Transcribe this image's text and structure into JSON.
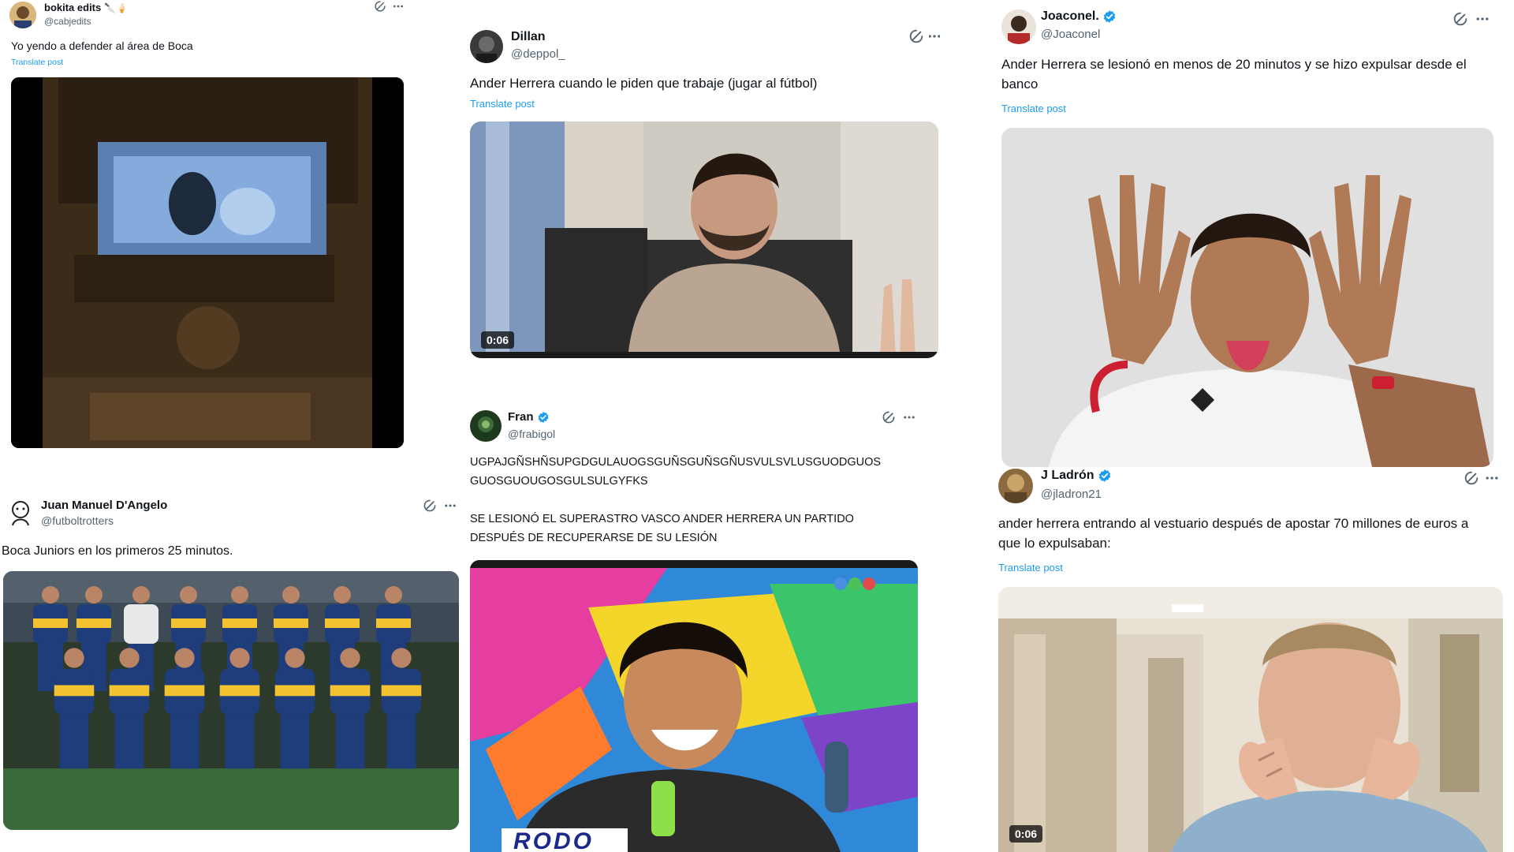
{
  "posts": [
    {
      "id": "bokita",
      "name": "bokita edits",
      "name_suffix": "🔪🍦",
      "handle": "@cabjedits",
      "text": "Yo yendo a defender al área de Boca",
      "translate": "Translate post"
    },
    {
      "id": "dillan",
      "name": "Dillan",
      "handle": "@deppol_",
      "text": "Ander Herrera cuando le piden que trabaje (jugar al fútbol)",
      "translate": "Translate post",
      "video_duration": "0:06"
    },
    {
      "id": "joaconel",
      "name": "Joaconel.",
      "verified": true,
      "handle": "@Joaconel",
      "text": "Ander Herrera se lesionó en menos de 20 minutos y se hizo expulsar desde el banco",
      "translate": "Translate post"
    },
    {
      "id": "juan",
      "name": "Juan Manuel D'Angelo",
      "handle": "@futboltrotters",
      "text": "Boca Juniors en los primeros 25 minutos."
    },
    {
      "id": "fran",
      "name": "Fran",
      "verified": true,
      "handle": "@frabigol",
      "text_line1": "UGPAJGÑSHÑSUPGDGULAUOGSGUÑSGUÑSGÑUSVULSVLUSGUODGUOS",
      "text_line2": "GUOSGUOUGOSGULSULGYFKS",
      "text_line3": "SE LESIONÓ EL SUPERASTRO VASCO ANDER HERRERA UN PARTIDO",
      "text_line4": "DESPUÉS DE RECUPERARSE DE SU LESIÓN",
      "media_caption": "RODO"
    },
    {
      "id": "jladron",
      "name": "J Ladrón",
      "verified": true,
      "handle": "@jladron21",
      "text": "ander herrera entrando al vestuario después de apostar 70 millones de euros a que lo expulsaban:",
      "translate": "Translate post",
      "video_duration": "0:06"
    }
  ],
  "colors": {
    "link": "#1d9bf0",
    "secondary": "#536471",
    "verified": "#1d9bf0",
    "boca_blue": "#1f3d7a",
    "boca_gold": "#f2c230"
  },
  "icons": [
    "grok-icon",
    "more-icon",
    "verified-icon",
    "avatar"
  ]
}
